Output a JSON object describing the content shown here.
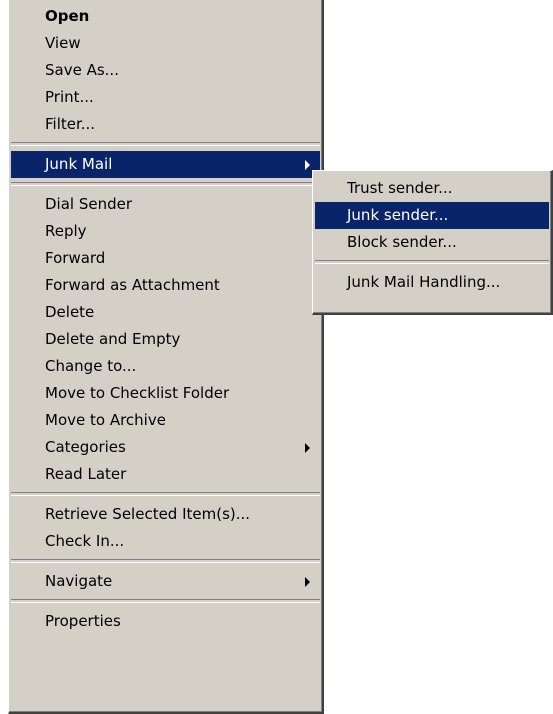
{
  "context_menu": {
    "items": [
      {
        "label": "Open"
      },
      {
        "label": "View"
      },
      {
        "label": "Save As..."
      },
      {
        "label": "Print..."
      },
      {
        "label": "Filter..."
      },
      {
        "label": "Junk Mail"
      },
      {
        "label": "Dial Sender"
      },
      {
        "label": "Reply"
      },
      {
        "label": "Forward"
      },
      {
        "label": "Forward as Attachment"
      },
      {
        "label": "Delete"
      },
      {
        "label": "Delete and Empty"
      },
      {
        "label": "Change to..."
      },
      {
        "label": "Move to Checklist Folder"
      },
      {
        "label": "Move to Archive"
      },
      {
        "label": "Categories"
      },
      {
        "label": "Read Later"
      },
      {
        "label": "Retrieve Selected Item(s)..."
      },
      {
        "label": "Check In..."
      },
      {
        "label": "Navigate"
      },
      {
        "label": "Properties"
      }
    ]
  },
  "junk_submenu": {
    "items": [
      {
        "label": "Trust sender..."
      },
      {
        "label": "Junk sender..."
      },
      {
        "label": "Block sender..."
      },
      {
        "label": "Junk Mail Handling..."
      }
    ]
  },
  "colors": {
    "menu_background": "#d4d0c8",
    "highlight_background": "#0a246a",
    "highlight_text": "#ffffff"
  },
  "icons": {
    "submenu_arrow": "chevron-right-icon"
  }
}
